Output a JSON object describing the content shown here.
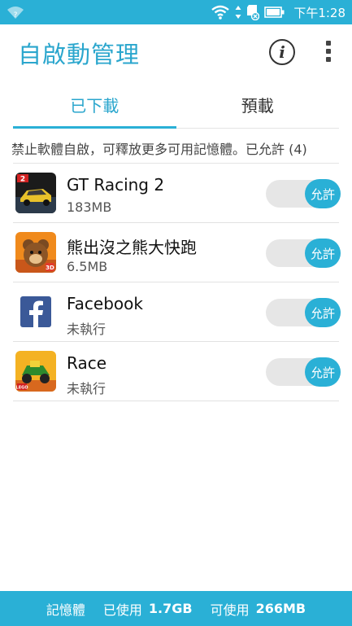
{
  "status_bar": {
    "time": "下午1:28",
    "left_icon": "wifi-unknown-icon",
    "icons": [
      "wifi-icon",
      "updown-arrows-icon",
      "sd-card-icon",
      "battery-icon"
    ]
  },
  "header": {
    "title": "自啟動管理",
    "info_icon": "info-icon",
    "more_icon": "more-vert-icon"
  },
  "tabs": [
    {
      "label": "已下載",
      "active": true
    },
    {
      "label": "預載",
      "active": false
    }
  ],
  "subtitle": "禁止軟體自啟，可釋放更多可用記憶體。已允許 (4)",
  "apps": [
    {
      "name": "GT Racing 2",
      "detail": "183MB",
      "toggle_label": "允許",
      "icon": "gt-racing-2-icon"
    },
    {
      "name": "熊出沒之熊大快跑",
      "detail": "6.5MB",
      "toggle_label": "允許",
      "icon": "boonie-bears-icon"
    },
    {
      "name": "Facebook",
      "detail": "未執行",
      "toggle_label": "允許",
      "icon": "facebook-icon"
    },
    {
      "name": "Race",
      "detail": "未執行",
      "toggle_label": "允許",
      "icon": "lego-race-icon"
    }
  ],
  "footer": {
    "memory_label": "記憶體",
    "used_label": "已使用",
    "used_value": "1.7GB",
    "available_label": "可使用",
    "available_value": "266MB"
  },
  "colors": {
    "accent": "#2ab0d6",
    "title_text": "#2aa6cd",
    "toggle_track": "#e6e6e6"
  }
}
